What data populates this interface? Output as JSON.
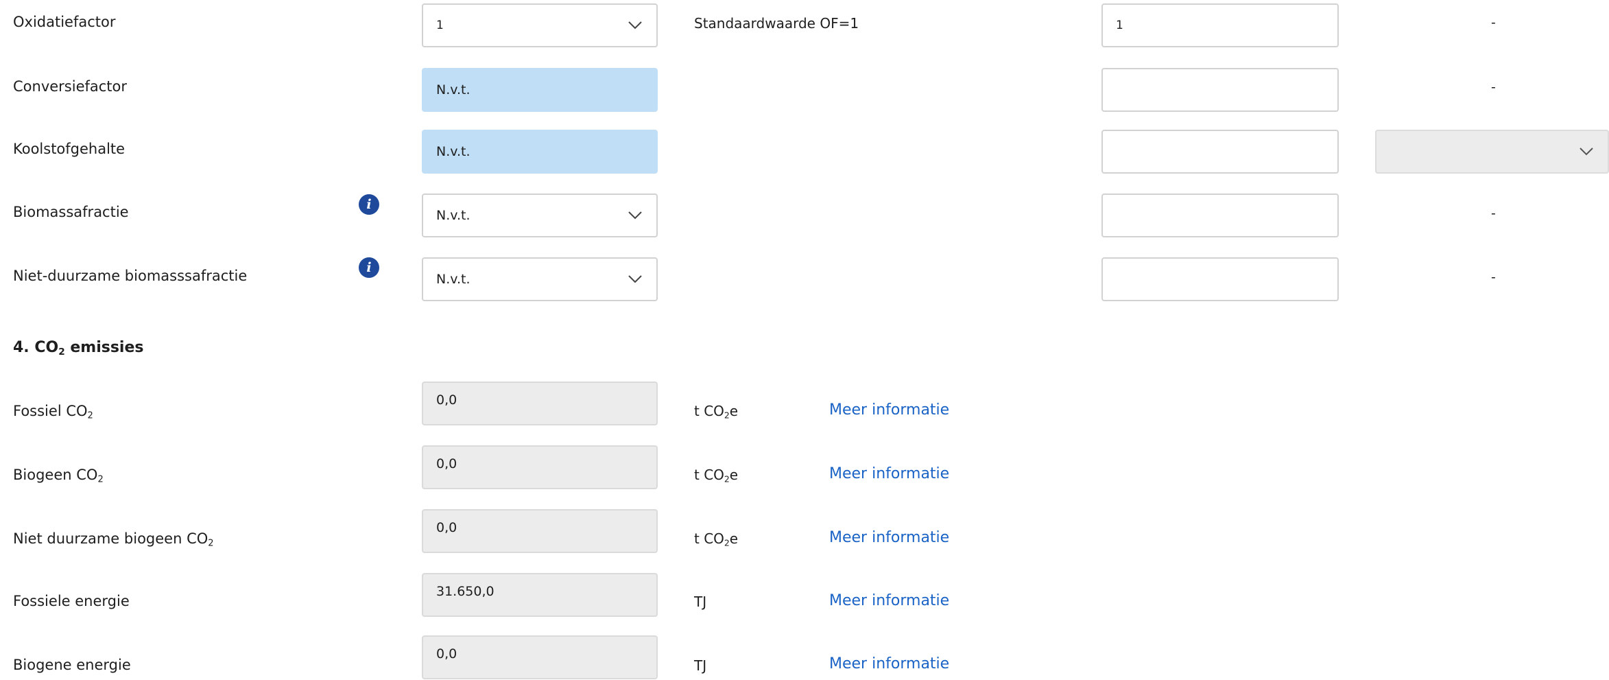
{
  "factors": [
    {
      "label": "Oxidatiefactor",
      "value": "1",
      "kind": "select",
      "note": "Standaardwaarde OF=1",
      "override": "1",
      "extra": "-"
    },
    {
      "label": "Conversiefactor",
      "value": "N.v.t.",
      "kind": "readonly",
      "note": "",
      "override": "",
      "extra": "-"
    },
    {
      "label": "Koolstofgehalte",
      "value": "N.v.t.",
      "kind": "readonly",
      "note": "",
      "override": "",
      "extra": ""
    },
    {
      "label": "Biomassafractie",
      "value": "N.v.t.",
      "kind": "select",
      "note": "",
      "override": "",
      "extra": "-"
    },
    {
      "label": "Niet-duurzame biomasssafractie",
      "value": "N.v.t.",
      "kind": "select",
      "note": "",
      "override": "",
      "extra": "-"
    }
  ],
  "section": {
    "number": "4.",
    "prefix": "CO",
    "sub": "2",
    "suffix": " emissies"
  },
  "emissions": [
    {
      "label_main": "Fossiel CO",
      "label_sub": "2",
      "value": "0,0",
      "unit_main": "t CO",
      "unit_sub": "2",
      "unit_suffix": "e",
      "link": "Meer informatie"
    },
    {
      "label_main": "Biogeen CO",
      "label_sub": "2",
      "value": "0,0",
      "unit_main": "t CO",
      "unit_sub": "2",
      "unit_suffix": "e",
      "link": "Meer informatie"
    },
    {
      "label_main": "Niet duurzame biogeen CO",
      "label_sub": "2",
      "value": "0,0",
      "unit_main": "t CO",
      "unit_sub": "2",
      "unit_suffix": "e",
      "link": "Meer informatie"
    },
    {
      "label_main": "Fossiele energie",
      "label_sub": "",
      "value": "31.650,0",
      "unit_main": "TJ",
      "unit_sub": "",
      "unit_suffix": "",
      "link": "Meer informatie"
    },
    {
      "label_main": "Biogene energie",
      "label_sub": "",
      "value": "0,0",
      "unit_main": "TJ",
      "unit_sub": "",
      "unit_suffix": "",
      "link": "Meer informatie"
    }
  ],
  "colors": {
    "info": "#1f4a9b",
    "readonly_blue": "#c0def5",
    "link": "#1a63c6",
    "disabled": "#ececec"
  },
  "icons": {
    "info": "info-icon",
    "chevron": "chevron-down-icon"
  }
}
